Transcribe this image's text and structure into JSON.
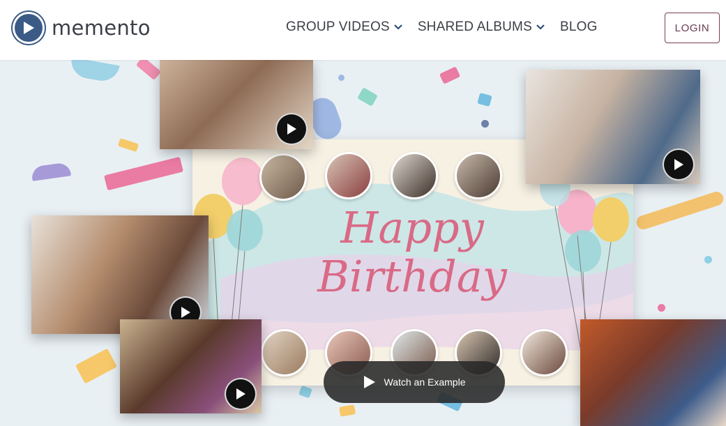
{
  "brand": {
    "name": "memento",
    "logo_icon": "play-circle-icon",
    "color": "#3b5a86"
  },
  "nav": {
    "items": [
      {
        "label": "GROUP VIDEOS",
        "has_dropdown": true
      },
      {
        "label": "SHARED ALBUMS",
        "has_dropdown": true
      },
      {
        "label": "BLOG",
        "has_dropdown": false
      }
    ],
    "login_label": "LOGIN"
  },
  "hero": {
    "card_title": "Happy Birthday",
    "watch_button_label": "Watch an Example",
    "colors": {
      "accent_pink": "#d96a86",
      "overlay": "#2b2b2b",
      "login_border": "#7a3b57"
    }
  }
}
